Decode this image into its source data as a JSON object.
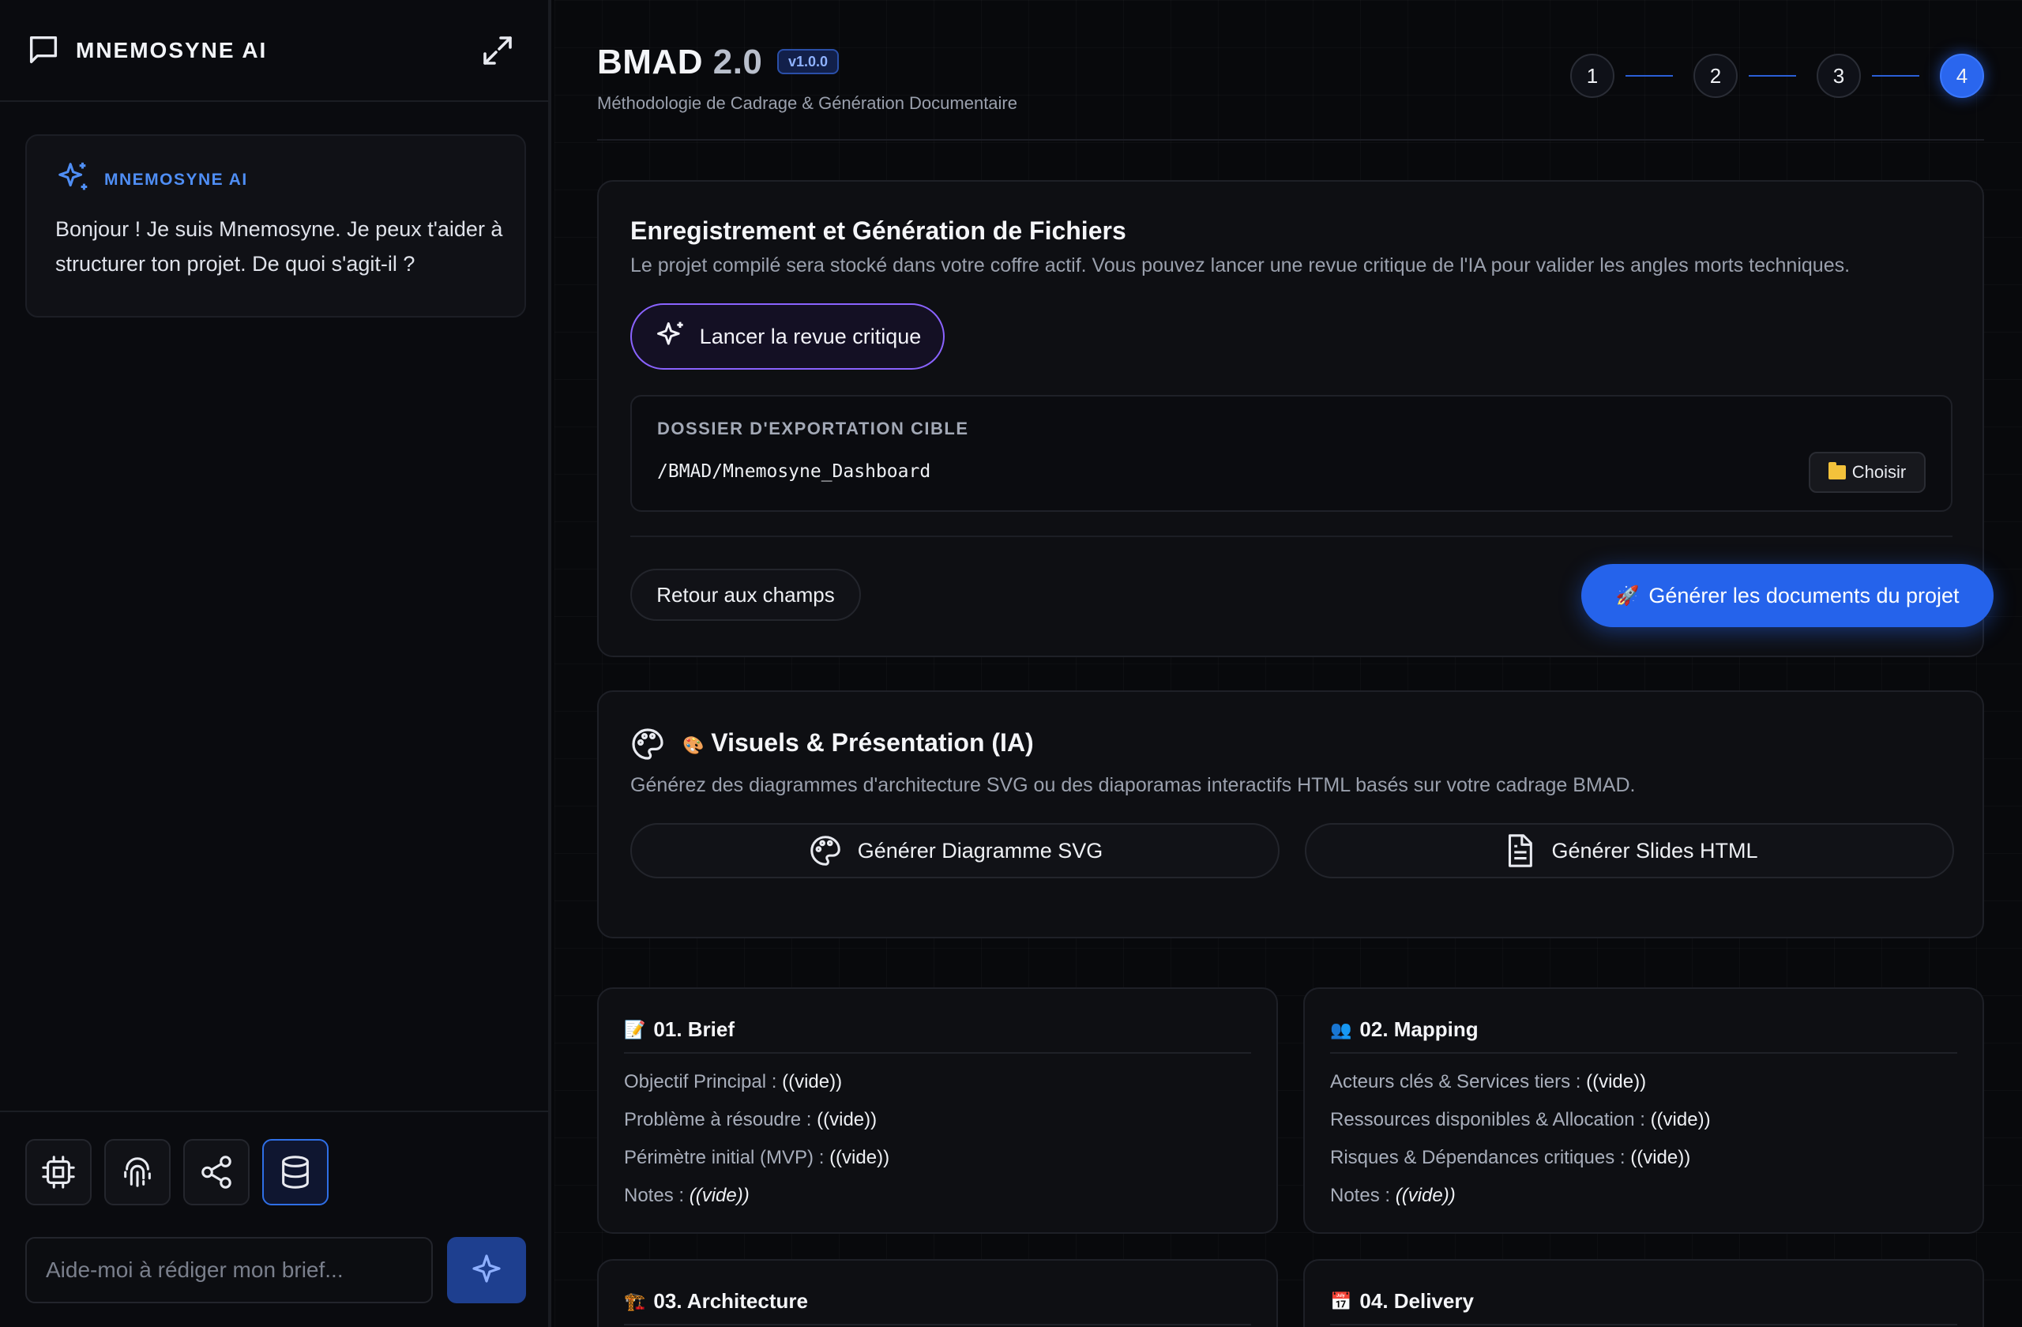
{
  "sidebar": {
    "title": "MNEMOSYNE AI",
    "ai_label": "MNEMOSYNE AI",
    "ai_message": "Bonjour ! Je suis Mnemosyne. Je peux t'aider à structurer ton projet. De quoi s'agit-il ?",
    "input_placeholder": "Aide-moi à rédiger mon brief...",
    "tools": [
      "cpu-icon",
      "fingerprint-icon",
      "share-icon",
      "database-icon"
    ]
  },
  "header": {
    "title": "BMAD",
    "version_num": "2.0",
    "badge": "v1.0.0",
    "subtitle": "Méthodologie de Cadrage & Génération Documentaire",
    "steps": [
      "1",
      "2",
      "3",
      "4"
    ],
    "active_step": 4
  },
  "files_card": {
    "title": "Enregistrement et Génération de Fichiers",
    "description": "Le projet compilé sera stocké dans votre coffre actif. Vous pouvez lancer une revue critique de l'IA pour valider les angles morts techniques.",
    "review_button": "Lancer la revue critique",
    "export_label": "DOSSIER D'EXPORTATION CIBLE",
    "export_path": "/BMAD/Mnemosyne_Dashboard",
    "choose_button": "Choisir",
    "back_button": "Retour aux champs",
    "generate_button": "Générer les documents du projet"
  },
  "visuals_card": {
    "title": "Visuels & Présentation (IA)",
    "description": "Générez des diagrammes d'architecture SVG ou des diaporamas interactifs HTML basés sur votre cadrage BMAD.",
    "svg_button": "Générer Diagramme SVG",
    "slides_button": "Générer Slides HTML"
  },
  "sections": {
    "brief": {
      "title": "01. Brief",
      "fields": [
        {
          "key": "Objectif Principal :",
          "value": "((vide))"
        },
        {
          "key": "Problème à résoudre :",
          "value": "((vide))"
        },
        {
          "key": "Périmètre initial (MVP) :",
          "value": "((vide))"
        },
        {
          "key": "Notes :",
          "value": "((vide))"
        }
      ]
    },
    "mapping": {
      "title": "02. Mapping",
      "fields": [
        {
          "key": "Acteurs clés & Services tiers :",
          "value": "((vide))"
        },
        {
          "key": "Ressources disponibles & Allocation :",
          "value": "((vide))"
        },
        {
          "key": "Risques & Dépendances critiques :",
          "value": "((vide))"
        },
        {
          "key": "Notes :",
          "value": "((vide))"
        }
      ]
    },
    "architecture": {
      "title": "03. Architecture"
    },
    "delivery": {
      "title": "04. Delivery"
    }
  },
  "colors": {
    "accent": "#2563eb",
    "purple": "#8a63ff",
    "background": "#07080b"
  }
}
